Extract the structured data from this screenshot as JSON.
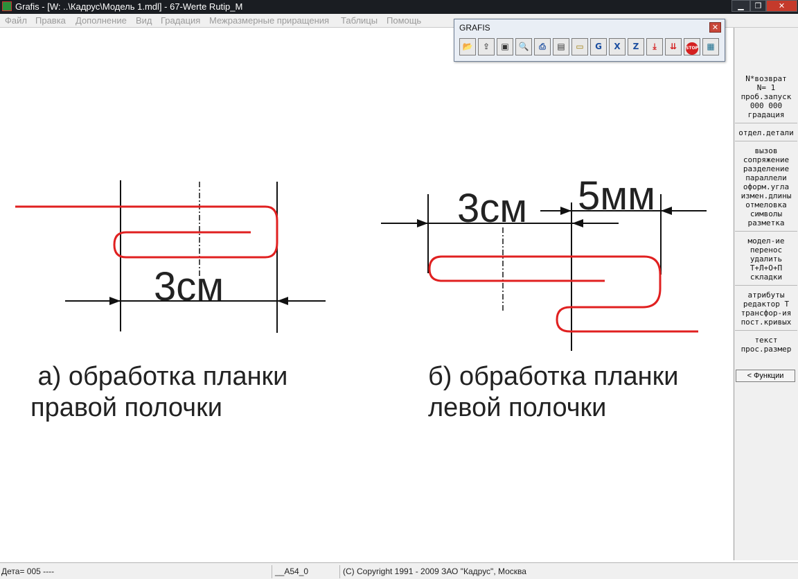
{
  "window": {
    "title": "Grafis - [W: ..\\Кадрус\\Модель 1.mdl] - 67-Werte Rutip_M",
    "minimize_label": "▁",
    "maximize_label": "❐",
    "close_label": "✕"
  },
  "menu": {
    "items": [
      "Файл",
      "Правка",
      "Дополнение",
      "Вид",
      "Градация",
      "Межразмерные приращения",
      "Таблицы",
      "Помощь"
    ]
  },
  "toolbar": {
    "title": "GRAFIS",
    "close_label": "✕",
    "buttons": [
      {
        "icon": "open-folder-icon",
        "glyph": "📂",
        "color": "#c9a227"
      },
      {
        "icon": "import-icon",
        "glyph": "⇪",
        "color": "#555555"
      },
      {
        "icon": "save-icon",
        "glyph": "▣",
        "color": "#333333"
      },
      {
        "icon": "zoom-icon",
        "glyph": "🔍",
        "color": "#1d4fa0"
      },
      {
        "icon": "print-icon",
        "glyph": "⎙",
        "color": "#1d4fa0"
      },
      {
        "icon": "layers-icon",
        "glyph": "▤",
        "color": "#333333"
      },
      {
        "icon": "ruler-icon",
        "glyph": "▭",
        "color": "#a08010"
      },
      {
        "icon": "grading-g-icon",
        "glyph": "G",
        "color": "#1d4fa0"
      },
      {
        "icon": "grading-x-icon",
        "glyph": "X",
        "color": "#1d4fa0"
      },
      {
        "icon": "grading-z-icon",
        "glyph": "Z",
        "color": "#1d4fa0"
      },
      {
        "icon": "download-icon",
        "glyph": "⤓",
        "color": "#d42020"
      },
      {
        "icon": "download-multi-icon",
        "glyph": "⇊",
        "color": "#d42020"
      },
      {
        "icon": "stop-icon",
        "glyph": "STOP",
        "color": "#ffffff"
      },
      {
        "icon": "monitor-icon",
        "glyph": "▦",
        "color": "#1d6f8f"
      }
    ]
  },
  "drawing": {
    "dim_3cm_a": "3см",
    "dim_3cm_b": "3см",
    "dim_5mm": "5мм",
    "caption_a": " а) обработка планки\nправой полочки",
    "caption_b": "б) обработка планки\nлевой полочки"
  },
  "right_panel": {
    "groups": [
      [
        "N*возврат",
        "N=  1",
        "проб.запуск",
        "000 000",
        "градация"
      ],
      [
        "отдел.детали"
      ],
      [
        "вызов",
        "сопряжение",
        "разделение",
        "параллели",
        "оформ.угла",
        "измен.длины",
        "отмеловка",
        "символы",
        "разметка"
      ],
      [
        "модел-ие",
        "перенос",
        "удалить",
        "Т+Л+О+П",
        "складки"
      ],
      [
        "атрибуты",
        "редактор Т",
        "трансфор-ия",
        "пост.кривых"
      ],
      [
        "текст",
        "прос.размер"
      ]
    ],
    "functions_button": "< Функции"
  },
  "status": {
    "detail": "Дета= 005  ----",
    "code": "__A54_0",
    "copyright": "(C) Copyright 1991 - 2009 ЗАО \"Кадрус\", Москва"
  }
}
